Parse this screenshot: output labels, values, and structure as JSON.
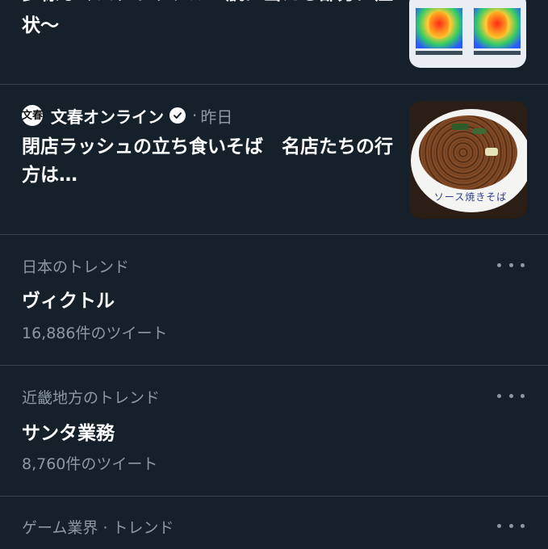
{
  "news": [
    {
      "headline": "多様なマスクトラブル　肌に当たる部分に症状〜"
    },
    {
      "source": "文春オンライン",
      "source_logo_text": "文春",
      "verified": true,
      "separator": "·",
      "time": "昨日",
      "headline": "閉店ラッシュの立ち食いそば　名店たちの行方は…",
      "thumbnail_text": "ソース焼きそば"
    }
  ],
  "trends": [
    {
      "context": "日本のトレンド",
      "name": "ヴィクトル",
      "count": "16,886件のツイート"
    },
    {
      "context": "近畿地方のトレンド",
      "name": "サンタ業務",
      "count": "8,760件のツイート"
    },
    {
      "context": "ゲーム業界 · トレンド"
    }
  ],
  "colors": {
    "background": "#15202b",
    "divider": "#38444d",
    "secondary_text": "#8b98a5",
    "primary_text": "#ffffff"
  },
  "icons": {
    "verified": "verified-badge-icon",
    "more": "more-horizontal-icon"
  }
}
